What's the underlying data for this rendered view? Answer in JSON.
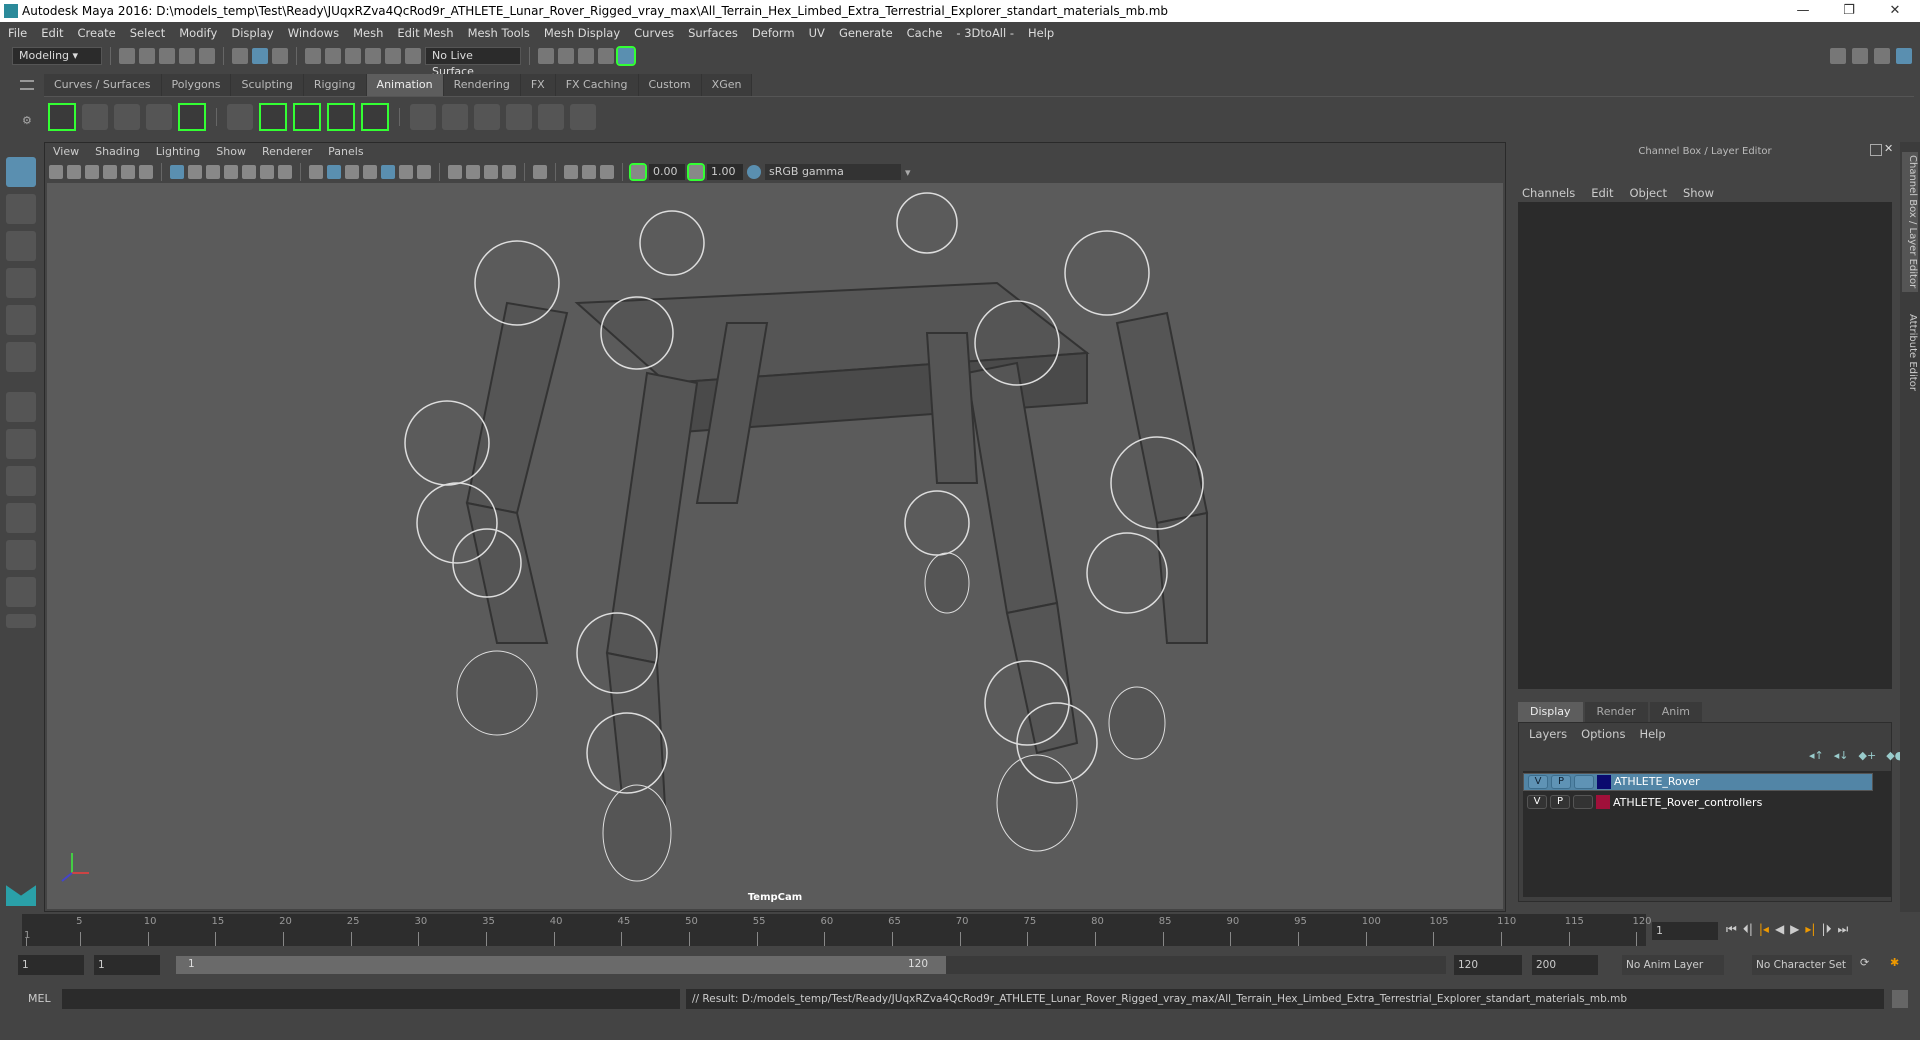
{
  "window": {
    "title": "Autodesk Maya 2016: D:\\models_temp\\Test\\Ready\\JUqxRZva4QcRod9r_ATHLETE_Lunar_Rover_Rigged_vray_max\\All_Terrain_Hex_Limbed_Extra_Terrestrial_Explorer_standart_materials_mb.mb"
  },
  "menubar": [
    "File",
    "Edit",
    "Create",
    "Select",
    "Modify",
    "Display",
    "Windows",
    "Mesh",
    "Edit Mesh",
    "Mesh Tools",
    "Mesh Display",
    "Curves",
    "Surfaces",
    "Deform",
    "UV",
    "Generate",
    "Cache",
    "- 3DtoAll -",
    "Help"
  ],
  "toolbar": {
    "mode": "Modeling",
    "live_surface": "No Live Surface"
  },
  "shelf_tabs": [
    "Curves / Surfaces",
    "Polygons",
    "Sculpting",
    "Rigging",
    "Animation",
    "Rendering",
    "FX",
    "FX Caching",
    "Custom",
    "XGen"
  ],
  "shelf_active": "Animation",
  "viewport": {
    "menus": [
      "View",
      "Shading",
      "Lighting",
      "Show",
      "Renderer",
      "Panels"
    ],
    "exposure": "0.00",
    "gamma": "1.00",
    "color_space": "sRGB gamma",
    "camera": "TempCam"
  },
  "channel_box": {
    "title": "Channel Box / Layer Editor",
    "menus": [
      "Channels",
      "Edit",
      "Object",
      "Show"
    ]
  },
  "layer_editor": {
    "tabs": [
      "Display",
      "Render",
      "Anim"
    ],
    "menus": [
      "Layers",
      "Options",
      "Help"
    ],
    "layers": [
      {
        "v": "V",
        "p": "P",
        "name": "ATHLETE_Rover",
        "color": "#0a0a6e",
        "selected": true
      },
      {
        "v": "V",
        "p": "P",
        "name": "ATHLETE_Rover_controllers",
        "color": "#a0103a",
        "selected": false
      }
    ]
  },
  "side_tabs": [
    "Channel Box / Layer Editor",
    "Attribute Editor"
  ],
  "timeline": {
    "ticks": [
      "5",
      "10",
      "15",
      "20",
      "25",
      "30",
      "35",
      "40",
      "45",
      "50",
      "55",
      "60",
      "65",
      "70",
      "75",
      "80",
      "85",
      "90",
      "95",
      "100",
      "105",
      "110",
      "115",
      "120"
    ],
    "start_label": "1",
    "current_frame": "1"
  },
  "range": {
    "start": "1",
    "playback_start": "1",
    "slider_start": "1",
    "slider_end": "120",
    "playback_end": "120",
    "end": "200",
    "anim_layer": "No Anim Layer",
    "character_set": "No Character Set"
  },
  "command": {
    "label": "MEL",
    "result": "// Result: D:/models_temp/Test/Ready/JUqxRZva4QcRod9r_ATHLETE_Lunar_Rover_Rigged_vray_max/All_Terrain_Hex_Limbed_Extra_Terrestrial_Explorer_standart_materials_mb.mb"
  }
}
